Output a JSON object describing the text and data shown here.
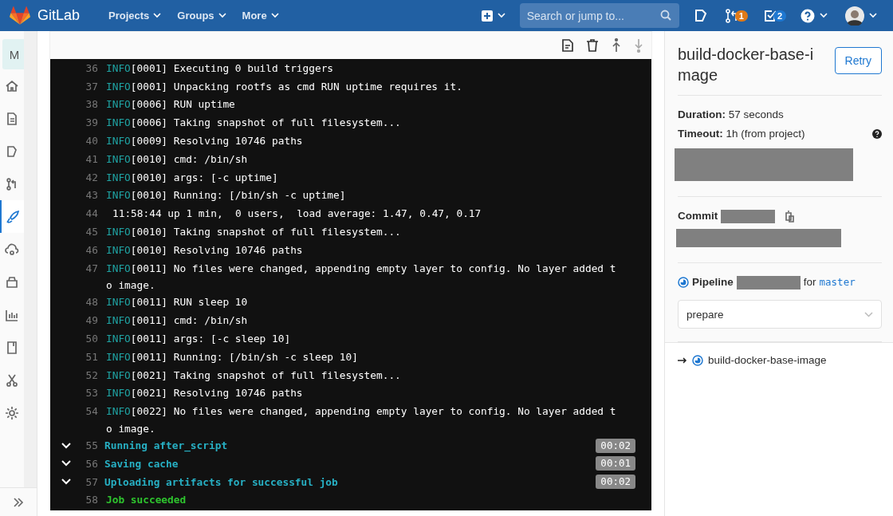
{
  "header": {
    "brand": "GitLab",
    "menus": [
      "Projects",
      "Groups",
      "More"
    ],
    "search": {
      "placeholder": "Search or jump to..."
    },
    "merge_requests_badge": "1",
    "todos_badge": "2"
  },
  "sidebar": {
    "project_letter": "M",
    "items": [
      {
        "kind": "home",
        "selected": false
      },
      {
        "kind": "file",
        "selected": false
      },
      {
        "kind": "issues",
        "selected": false
      },
      {
        "kind": "merge",
        "selected": false
      },
      {
        "kind": "rocket",
        "selected": true
      },
      {
        "kind": "cloud",
        "selected": false
      },
      {
        "kind": "package",
        "selected": false
      },
      {
        "kind": "chart",
        "selected": false
      },
      {
        "kind": "book",
        "selected": false
      },
      {
        "kind": "scissors",
        "selected": false
      },
      {
        "kind": "gear",
        "selected": false
      }
    ]
  },
  "log": [
    {
      "kind": "info",
      "number": "36",
      "tag": "INFO",
      "stamp": "[0001]",
      "text": " Executing 0 build triggers"
    },
    {
      "kind": "info",
      "number": "37",
      "tag": "INFO",
      "stamp": "[0001]",
      "text": " Unpacking rootfs as cmd RUN uptime requires it."
    },
    {
      "kind": "info",
      "number": "38",
      "tag": "INFO",
      "stamp": "[0006]",
      "text": " RUN uptime"
    },
    {
      "kind": "info",
      "number": "39",
      "tag": "INFO",
      "stamp": "[0006]",
      "text": " Taking snapshot of full filesystem..."
    },
    {
      "kind": "info",
      "number": "40",
      "tag": "INFO",
      "stamp": "[0009]",
      "text": " Resolving 10746 paths"
    },
    {
      "kind": "info",
      "number": "41",
      "tag": "INFO",
      "stamp": "[0010]",
      "text": " cmd: /bin/sh"
    },
    {
      "kind": "info",
      "number": "42",
      "tag": "INFO",
      "stamp": "[0010]",
      "text": " args: [-c uptime]"
    },
    {
      "kind": "info",
      "number": "43",
      "tag": "INFO",
      "stamp": "[0010]",
      "text": " Running: [/bin/sh -c uptime]"
    },
    {
      "kind": "plain",
      "number": "44",
      "text": "11:58:44 up 1 min,  0 users,  load average: 1.47, 0.47, 0.17"
    },
    {
      "kind": "info",
      "number": "45",
      "tag": "INFO",
      "stamp": "[0010]",
      "text": " Taking snapshot of full filesystem..."
    },
    {
      "kind": "info",
      "number": "46",
      "tag": "INFO",
      "stamp": "[0010]",
      "text": " Resolving 10746 paths"
    },
    {
      "kind": "info",
      "number": "47",
      "tag": "INFO",
      "stamp": "[0011]",
      "text": " No files were changed, appending empty layer to config. No layer added t"
    },
    {
      "kind": "continuation",
      "text": "o image."
    },
    {
      "kind": "info",
      "number": "48",
      "tag": "INFO",
      "stamp": "[0011]",
      "text": " RUN sleep 10"
    },
    {
      "kind": "info",
      "number": "49",
      "tag": "INFO",
      "stamp": "[0011]",
      "text": " cmd: /bin/sh"
    },
    {
      "kind": "info",
      "number": "50",
      "tag": "INFO",
      "stamp": "[0011]",
      "text": " args: [-c sleep 10]"
    },
    {
      "kind": "info",
      "number": "51",
      "tag": "INFO",
      "stamp": "[0011]",
      "text": " Running: [/bin/sh -c sleep 10]"
    },
    {
      "kind": "info",
      "number": "52",
      "tag": "INFO",
      "stamp": "[0021]",
      "text": " Taking snapshot of full filesystem..."
    },
    {
      "kind": "info",
      "number": "53",
      "tag": "INFO",
      "stamp": "[0021]",
      "text": " Resolving 10746 paths"
    },
    {
      "kind": "info",
      "number": "54",
      "tag": "INFO",
      "stamp": "[0022]",
      "text": " No files were changed, appending empty layer to config. No layer added t"
    },
    {
      "kind": "continuation",
      "text": "o image."
    },
    {
      "kind": "section",
      "number": "55",
      "text": "Running after_script",
      "duration": "00:02",
      "expanded": true
    },
    {
      "kind": "section",
      "number": "56",
      "text": "Saving cache",
      "duration": "00:01",
      "expanded": true
    },
    {
      "kind": "section",
      "number": "57",
      "text": "Uploading artifacts for successful job",
      "duration": "00:02",
      "expanded": true
    },
    {
      "kind": "success",
      "number": "58",
      "text": "Job succeeded"
    }
  ],
  "job": {
    "title": "build-docker-base-image",
    "retry": "Retry",
    "duration_label": "Duration:",
    "duration": "57 seconds",
    "timeout_label": "Timeout:",
    "timeout": "1h (from project)",
    "commit_label": "Commit",
    "pipeline_label": "Pipeline",
    "for": "for",
    "branch": "master",
    "stage": "prepare",
    "jobs": [
      {
        "name": "build-docker-base-image",
        "selected": true
      }
    ]
  }
}
